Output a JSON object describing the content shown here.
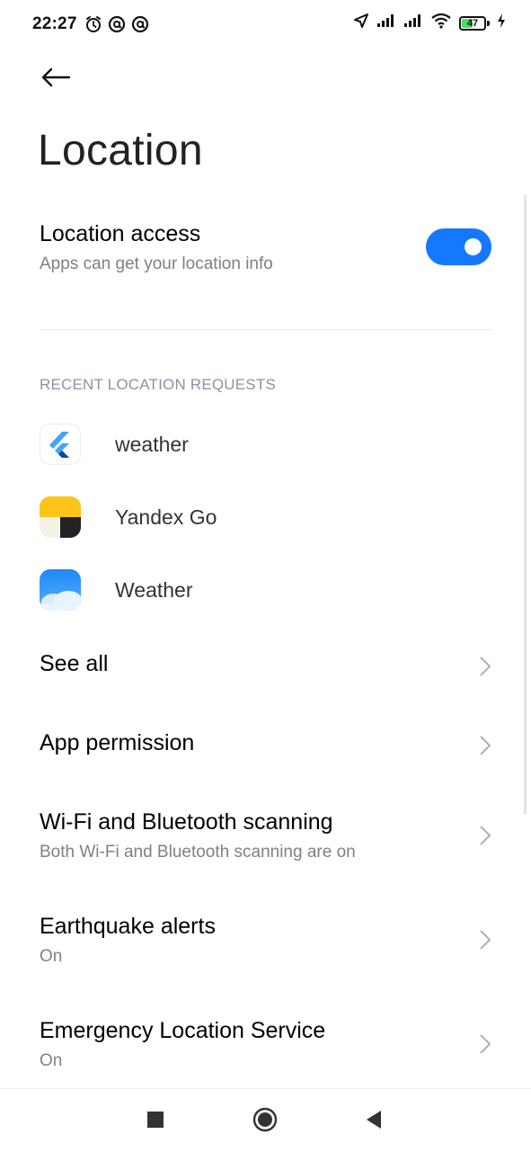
{
  "status_bar": {
    "time": "22:27",
    "battery_level": "47",
    "battery_fraction": 0.47,
    "battery_color": "#4cd964",
    "left_icons": [
      "alarm-icon",
      "vpn-at-icon",
      "vpn-at-icon"
    ],
    "right_icons": [
      "location-arrow-icon",
      "signal-icon",
      "signal-icon",
      "wifi-icon",
      "battery-icon",
      "charging-icon"
    ]
  },
  "header": {
    "back_icon": "arrow-left-icon",
    "title": "Location"
  },
  "location_access": {
    "title": "Location access",
    "subtitle": "Apps can get your location info",
    "enabled": true,
    "toggle_color": "#1677ff"
  },
  "recent_requests": {
    "header": "RECENT LOCATION REQUESTS",
    "apps": [
      {
        "name": "weather",
        "icon": "flutter-icon"
      },
      {
        "name": "Yandex Go",
        "icon": "yandex-go-icon"
      },
      {
        "name": "Weather",
        "icon": "weather-app-icon"
      }
    ]
  },
  "menu": [
    {
      "title": "See all",
      "subtitle": ""
    },
    {
      "title": "App permission",
      "subtitle": ""
    },
    {
      "title": "Wi-Fi and Bluetooth scanning",
      "subtitle": "Both Wi-Fi and Bluetooth scanning are on"
    },
    {
      "title": "Earthquake alerts",
      "subtitle": "On"
    },
    {
      "title": "Emergency Location Service",
      "subtitle": "On"
    }
  ],
  "nav_bar": {
    "buttons": [
      "recents-square-icon",
      "home-circle-icon",
      "back-triangle-icon"
    ]
  }
}
